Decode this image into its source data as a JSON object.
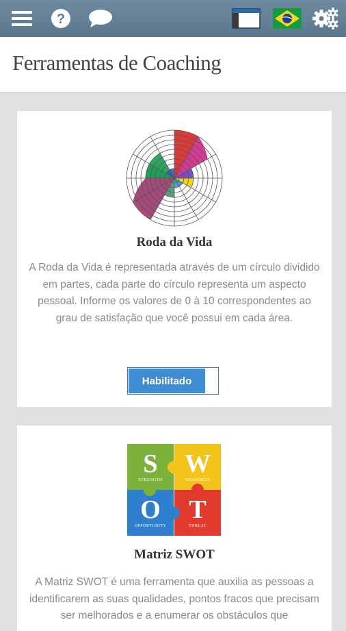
{
  "header": {
    "icons": [
      "menu-icon",
      "help-icon",
      "chat-icon",
      "window-icon",
      "brazil-flag-icon",
      "settings-icon"
    ]
  },
  "page": {
    "title": "Ferramentas de Coaching"
  },
  "cards": [
    {
      "title": "Roda da Vida",
      "description": "A Roda da Vida é representada através de um círculo dividido em partes, cada parte do círculo representa um aspecto pessoal. Informe os valores de 0 à 10 correspondentes ao grau de satisfação que você possui em cada área.",
      "toggle_label": "Habilitado"
    },
    {
      "title": "Matriz SWOT",
      "description": "A Matriz SWOT é uma ferramenta que auxilia as pessoas a identificarem as suas qualidades, pontos fracos que precisam ser melhorados e a enumerar os obstáculos que",
      "swot": [
        {
          "letter": "S",
          "word": "STRENGTH",
          "color": "#7cb23b"
        },
        {
          "letter": "W",
          "word": "WEAKNESS",
          "color": "#f2c41a"
        },
        {
          "letter": "O",
          "word": "OPPORTUNITY",
          "color": "#2f7fcf"
        },
        {
          "letter": "T",
          "word": "THREAT",
          "color": "#e23a2c"
        }
      ]
    }
  ],
  "colors": {
    "header": "#627e95",
    "toggle": "#3e8dd4"
  }
}
